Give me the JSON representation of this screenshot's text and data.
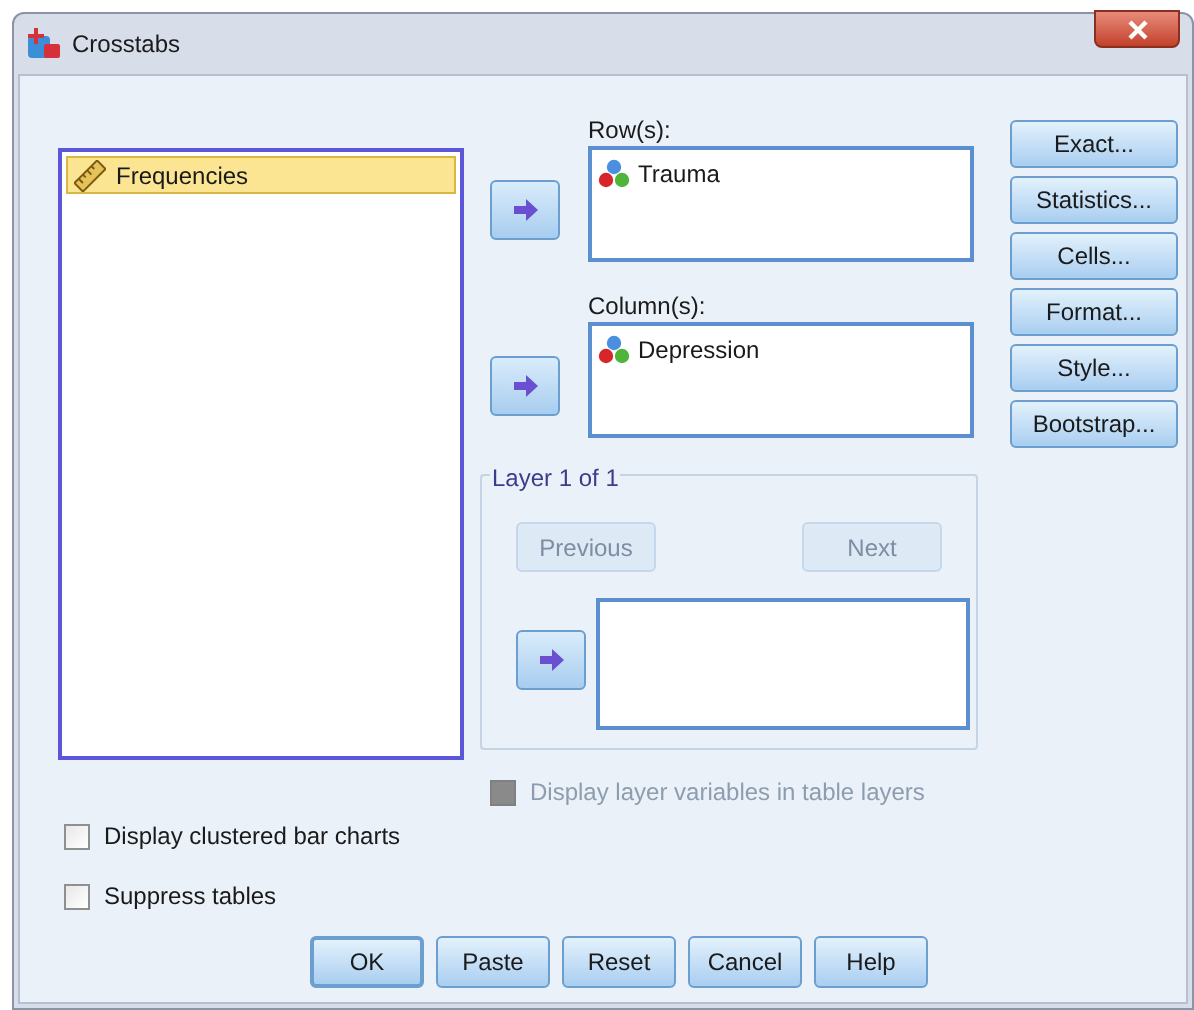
{
  "window": {
    "title": "Crosstabs"
  },
  "variables": [
    {
      "label": "Frequencies",
      "selected": true
    }
  ],
  "rows": {
    "label": "Row(s):",
    "items": [
      "Trauma"
    ]
  },
  "columns": {
    "label": "Column(s):",
    "items": [
      "Depression"
    ]
  },
  "layer": {
    "title": "Layer 1 of 1",
    "previous": {
      "label": "Previous",
      "disabled": true
    },
    "next": {
      "label": "Next",
      "disabled": true
    },
    "display_option": {
      "label": "Display layer variables in table layers",
      "checked": false,
      "disabled": true
    }
  },
  "side_buttons": [
    "Exact...",
    "Statistics...",
    "Cells...",
    "Format...",
    "Style...",
    "Bootstrap..."
  ],
  "options": [
    {
      "label": "Display clustered bar charts",
      "checked": false
    },
    {
      "label": "Suppress tables",
      "checked": false
    }
  ],
  "buttons": [
    {
      "label": "OK",
      "default": true
    },
    {
      "label": "Paste",
      "default": false
    },
    {
      "label": "Reset",
      "default": false
    },
    {
      "label": "Cancel",
      "default": false
    },
    {
      "label": "Help",
      "default": false
    }
  ]
}
